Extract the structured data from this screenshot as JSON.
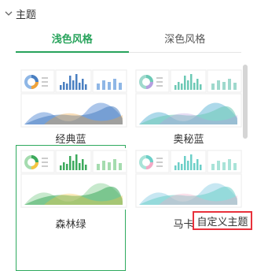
{
  "section": {
    "title": "主题",
    "icon": "chevron-down-icon"
  },
  "tabs": [
    {
      "label": "浅色风格",
      "active": true
    },
    {
      "label": "深色风格",
      "active": false
    }
  ],
  "themes": [
    {
      "label": "经典蓝",
      "selected": false,
      "colors": [
        "#4a7fc1",
        "#f0a33a",
        "#8fb7e6",
        "#5a8ed6"
      ]
    },
    {
      "label": "奥秘蓝",
      "selected": false,
      "colors": [
        "#6cc9b5",
        "#b69fe0",
        "#9fd9cd",
        "#5bb3d6"
      ]
    },
    {
      "label": "森林绿",
      "selected": true,
      "colors": [
        "#3daa5c",
        "#f5c542",
        "#a5dcaf",
        "#8fd39c"
      ]
    },
    {
      "label": "马卡龙",
      "selected": false,
      "colors": [
        "#6ccfc8",
        "#f4a9c6",
        "#a9e3d8",
        "#8fd0e5"
      ]
    }
  ],
  "custom_button": {
    "label": "自定义主题"
  },
  "colors": {
    "accent": "#27a35b",
    "highlight": "#e8313b"
  }
}
